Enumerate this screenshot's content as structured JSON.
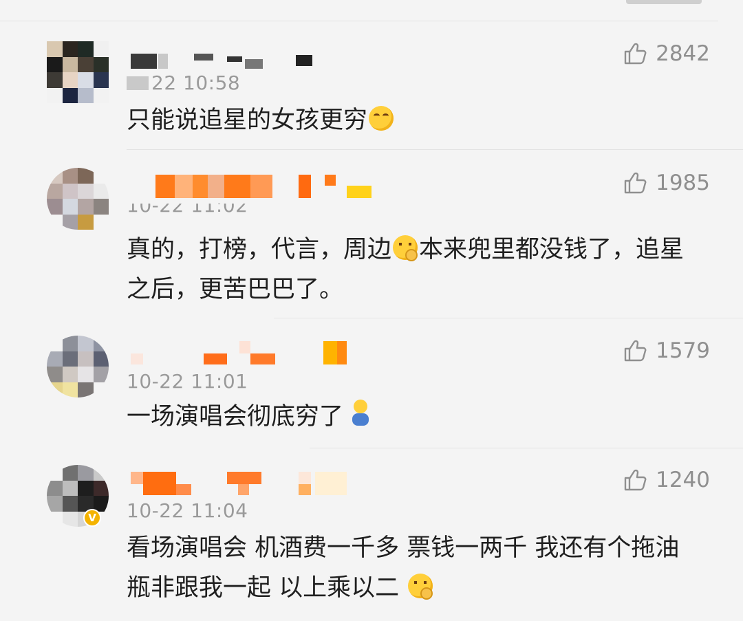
{
  "comments": [
    {
      "time": "22 10:58",
      "likes": "2842",
      "text": "只能说追星的女孩更穷",
      "emoji": "laugh-cry-emoji"
    },
    {
      "time": "10-22 11:02",
      "likes": "1985",
      "text_a": "真的，打榜，代言，周边",
      "text_b": "本来兜里都没钱了，追星之后，更苦巴巴了。",
      "emoji": "thinking-emoji"
    },
    {
      "time": "10-22 11:01",
      "likes": "1579",
      "text": "一场演唱会彻底穷了",
      "emoji": "cheering-emoji"
    },
    {
      "time": "10-22 11:04",
      "likes": "1240",
      "text": "看场演唱会 机酒费一千多 票钱一两千 我还有个拖油瓶非跟我一起 以上乘以二",
      "emoji": "thinking-emoji",
      "verified": true
    }
  ],
  "colors": {
    "background": "#f4f4f4",
    "meta_gray": "#9a9a9a",
    "text": "#1f1f1f",
    "verified_badge": "#f4b300"
  }
}
